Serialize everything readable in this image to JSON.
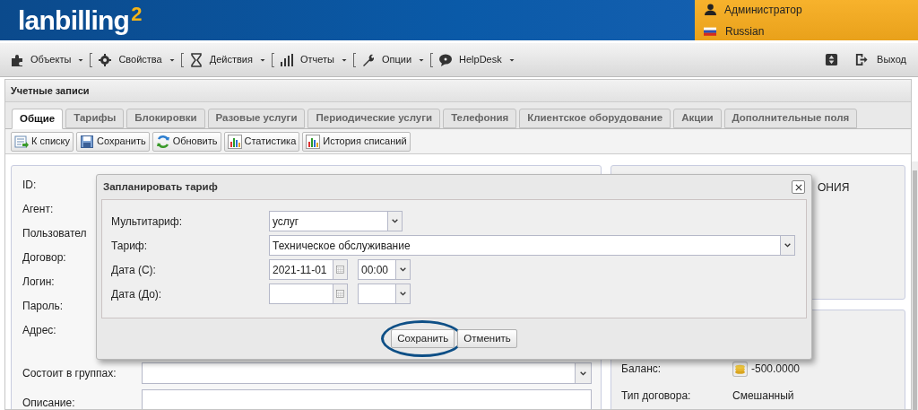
{
  "header": {
    "logo": "lanbilling",
    "logo_sup": "2",
    "user": "Администратор",
    "language": "Russian"
  },
  "menu": {
    "items": [
      {
        "label": "Объекты"
      },
      {
        "label": "Свойства"
      },
      {
        "label": "Действия"
      },
      {
        "label": "Отчеты"
      },
      {
        "label": "Опции"
      },
      {
        "label": "HelpDesk"
      }
    ],
    "logout": "Выход"
  },
  "panel": {
    "title": "Учетные записи",
    "tabs": [
      {
        "label": "Общие",
        "selected": true
      },
      {
        "label": "Тарифы",
        "selected": false
      },
      {
        "label": "Блокировки",
        "selected": false
      },
      {
        "label": "Разовые услуги",
        "selected": false
      },
      {
        "label": "Периодические услуги",
        "selected": false
      },
      {
        "label": "Телефония",
        "selected": false
      },
      {
        "label": "Клиентское оборудование",
        "selected": false
      },
      {
        "label": "Акции",
        "selected": false
      },
      {
        "label": "Дополнительные поля",
        "selected": false
      }
    ],
    "toolbar": [
      {
        "label": "К списку"
      },
      {
        "label": "Сохранить"
      },
      {
        "label": "Обновить"
      },
      {
        "label": "Статистика"
      },
      {
        "label": "История списаний"
      }
    ]
  },
  "form": {
    "fields": [
      {
        "label": "ID:"
      },
      {
        "label": "Агент:"
      },
      {
        "label": "Пользовател"
      },
      {
        "label": "Договор:"
      },
      {
        "label": "Логин:"
      },
      {
        "label": "Пароль:"
      },
      {
        "label": "Адрес:"
      }
    ],
    "groups_label": "Состоит в группах:",
    "description_label": "Описание:"
  },
  "right": {
    "top_text": "ОНИЯ",
    "balance_label": "Баланс:",
    "balance": "-500.0000",
    "contract_type_label": "Тип договора:",
    "contract_type": "Смешанный"
  },
  "dialog": {
    "title": "Запланировать тариф",
    "rows": [
      {
        "label": "Мультитариф:",
        "kind": "combo",
        "value": "услуг"
      },
      {
        "label": "Тариф:",
        "kind": "wide-combo",
        "value": "Техническое обслуживание"
      },
      {
        "label": "Дата (С):",
        "kind": "datetime",
        "value": "2021-11-01",
        "time": "00:00"
      },
      {
        "label": "Дата (До):",
        "kind": "datetime"
      }
    ],
    "buttons": [
      {
        "label": "Сохранить",
        "highlighted": true
      },
      {
        "label": "Отменить",
        "highlighted": false
      }
    ]
  }
}
